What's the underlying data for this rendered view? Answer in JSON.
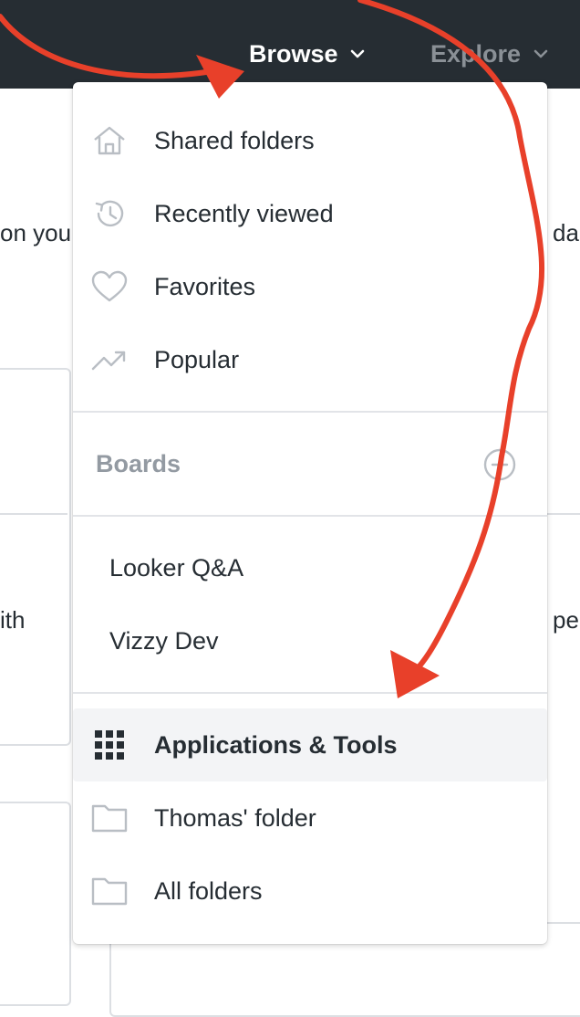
{
  "nav": {
    "browse_label": "Browse",
    "explore_label": "Explore"
  },
  "background": {
    "fragment_left_1": "on you",
    "fragment_right_1": "da",
    "fragment_left_2": "ith",
    "fragment_right_2": "per"
  },
  "menu": {
    "top_items": [
      {
        "label": "Shared folders",
        "icon": "home-icon"
      },
      {
        "label": "Recently viewed",
        "icon": "history-icon"
      },
      {
        "label": "Favorites",
        "icon": "heart-icon"
      },
      {
        "label": "Popular",
        "icon": "trending-icon"
      }
    ],
    "boards_title": "Boards",
    "boards_add_icon": "add-circle-icon",
    "boards": [
      {
        "label": "Looker Q&A"
      },
      {
        "label": "Vizzy Dev"
      }
    ],
    "folder_items": [
      {
        "label": "Applications & Tools",
        "icon": "grid-icon",
        "active": true
      },
      {
        "label": "Thomas' folder",
        "icon": "folder-icon"
      },
      {
        "label": "All folders",
        "icon": "folder-icon"
      }
    ]
  },
  "colors": {
    "topbar": "#262d33",
    "accent_arrow": "#e8402a",
    "active_row": "#f3f4f6",
    "muted_text": "#939aa2"
  }
}
